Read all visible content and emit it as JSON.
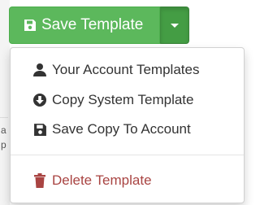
{
  "toolbar": {
    "save_template_label": "Save Template",
    "caret_icon": "caret-down-icon",
    "save_icon": "floppy-disk-icon"
  },
  "dropdown": {
    "items": [
      {
        "label": "Your Account Templates",
        "icon": "user-icon"
      },
      {
        "label": "Copy System Template",
        "icon": "circle-arrow-down-icon"
      },
      {
        "label": "Save Copy To Account",
        "icon": "floppy-disk-icon"
      }
    ],
    "delete_item": {
      "label": "Delete Template",
      "icon": "trash-icon"
    }
  },
  "background_fragments": {
    "a": "a",
    "p": "p"
  },
  "colors": {
    "success": "#5cb85c",
    "success_active": "#449d44",
    "danger": "#a94442",
    "text": "#333333"
  }
}
